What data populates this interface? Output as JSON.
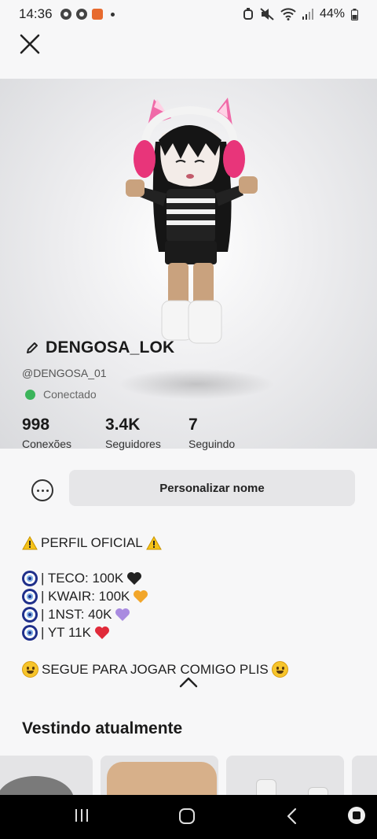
{
  "status_bar": {
    "time": "14:36",
    "battery": "44%"
  },
  "profile": {
    "display_name": "DENGOSA_LOK",
    "username": "@DENGOSA_01",
    "presence": "Conectado",
    "presence_color": "#3bb45a"
  },
  "stats": [
    {
      "value": "998",
      "label": "Conexões"
    },
    {
      "value": "3.4K",
      "label": "Seguidores"
    },
    {
      "value": "7",
      "label": "Seguindo"
    }
  ],
  "actions": {
    "edit_name_label": "Personalizar nome"
  },
  "bio": {
    "title": "PERFIL OFICIAL",
    "lines": [
      {
        "text": "| TECO: 100K",
        "heart_color": "#222222"
      },
      {
        "text": "| KWAIR: 100K",
        "heart_color": "#f2a62a"
      },
      {
        "text": "| 1NST: 40K",
        "heart_color": "#a98be0"
      },
      {
        "text": "| YT 11K",
        "heart_color": "#e02a3a"
      }
    ],
    "closing": "SEGUE PARA JOGAR COMIGO PLIS"
  },
  "wearing": {
    "title": "Vestindo atualmente"
  },
  "colors": {
    "background": "#f7f7f8",
    "button_bg": "#e6e6e8",
    "nav_bar": "#000000"
  }
}
